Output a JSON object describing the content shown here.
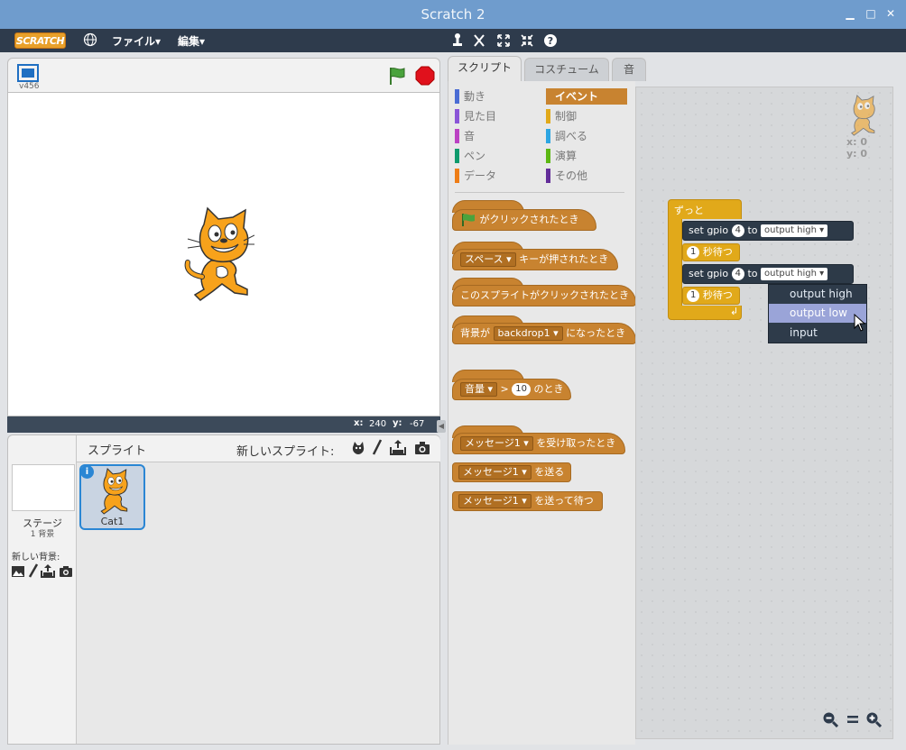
{
  "window": {
    "title": "Scratch 2"
  },
  "menubar": {
    "logo_text": "SCRATCH",
    "file_label": "ファイル▾",
    "edit_label": "編集▾"
  },
  "stage": {
    "version_label": "v456",
    "coords": {
      "x_label": "x:",
      "x_value": "240",
      "y_label": "y:",
      "y_value": "-67"
    }
  },
  "sprites": {
    "header_label": "スプライト",
    "new_sprite_label": "新しいスプライト:",
    "stage_label": "ステージ",
    "stage_count": "1 背景",
    "new_backdrop_label": "新しい背景:",
    "items": [
      {
        "name": "Cat1"
      }
    ]
  },
  "tabs": [
    {
      "label": "スクリプト",
      "active": true
    },
    {
      "label": "コスチューム",
      "active": false
    },
    {
      "label": "音",
      "active": false
    }
  ],
  "categories": {
    "left": [
      {
        "label": "動き",
        "color": "#4a6cd4"
      },
      {
        "label": "見た目",
        "color": "#8a55d7"
      },
      {
        "label": "音",
        "color": "#bb42c3"
      },
      {
        "label": "ペン",
        "color": "#0e9a6c"
      },
      {
        "label": "データ",
        "color": "#ee7d16"
      }
    ],
    "right": [
      {
        "label": "イベント",
        "color": "#c88330",
        "active": true
      },
      {
        "label": "制御",
        "color": "#e1a91a"
      },
      {
        "label": "調べる",
        "color": "#2ca5e2"
      },
      {
        "label": "演算",
        "color": "#5cb712"
      },
      {
        "label": "その他",
        "color": "#632d99"
      }
    ]
  },
  "palette_blocks": {
    "flag_hat": "がクリックされたとき",
    "key_hat_dd": "スペース",
    "key_hat_text": "キーが押されたとき",
    "sprite_click_hat": "このスプライトがクリックされたとき",
    "backdrop_hat_pre": "背景が",
    "backdrop_hat_dd": "backdrop1",
    "backdrop_hat_post": "になったとき",
    "volume_hat_dd": "音量",
    "volume_hat_op": ">",
    "volume_hat_num": "10",
    "volume_hat_post": "のとき",
    "receive_hat_dd": "メッセージ1",
    "receive_hat_text": "を受け取ったとき",
    "broadcast_dd": "メッセージ1",
    "broadcast_text": "を送る",
    "broadcast_wait_dd": "メッセージ1",
    "broadcast_wait_text": "を送って待つ"
  },
  "scripts_area": {
    "sprite_x": "x: 0",
    "sprite_y": "y: 0",
    "forever_label": "ずっと",
    "gpio1": {
      "set": "set",
      "gpio": "gpio",
      "pin": "4",
      "to": "to",
      "value": "output high"
    },
    "wait1": {
      "num": "1",
      "text": "秒待つ"
    },
    "gpio2": {
      "set": "set",
      "gpio": "gpio",
      "pin": "4",
      "to": "to",
      "value": "output high"
    },
    "wait2": {
      "num": "1",
      "text": "秒待つ"
    }
  },
  "dropdown": {
    "options": [
      "output high",
      "output low",
      "input"
    ],
    "highlighted": "output low"
  }
}
